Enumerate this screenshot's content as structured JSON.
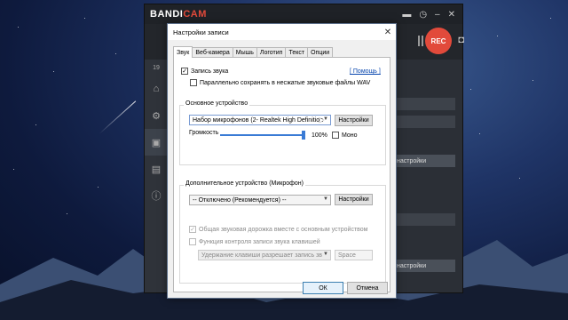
{
  "bandicam": {
    "logo_main": "BANDI",
    "logo_accent": "CAM",
    "rec_label": "REC",
    "side_number": "19",
    "right_buttons": [
      "настройки",
      "настройки"
    ]
  },
  "dialog": {
    "title": "Настройки записи",
    "close_glyph": "✕",
    "tabs": [
      "Звук",
      "Веб-камера",
      "Мышь",
      "Логотип",
      "Текст",
      "Опции"
    ],
    "active_tab": 0,
    "record_sound": {
      "label": "Запись звука",
      "checked": true
    },
    "help_link": "[ Помощь ]",
    "save_wav": {
      "label": "Параллельно сохранять в несжатые звуковые файлы WAV",
      "checked": false
    },
    "primary_device": {
      "group_label": "Основное устройство",
      "selected": "Набор микрофонов (2- Realtek High Definition",
      "settings_button": "Настройки",
      "volume_label": "Громкость",
      "volume_value": "100%",
      "volume_level": 1.0,
      "mono": {
        "label": "Моно",
        "checked": false
      }
    },
    "secondary_device": {
      "group_label": "Дополнительное устройство (Микрофон)",
      "selected": "-- Отключено (Рекомендуется) --",
      "settings_button": "Настройки",
      "common_track": {
        "label": "Общая звуковая дорожка вместе с основным устройством",
        "checked": true,
        "disabled": true
      },
      "hotkey_control": {
        "label": "Функция контроля записи звука клавишей",
        "checked": false,
        "disabled": true
      },
      "hotkey_mode": "Удержание клавиши разрешает запись зв",
      "hotkey_key": "Space"
    },
    "ok_button": "ОК",
    "cancel_button": "Отмена"
  }
}
